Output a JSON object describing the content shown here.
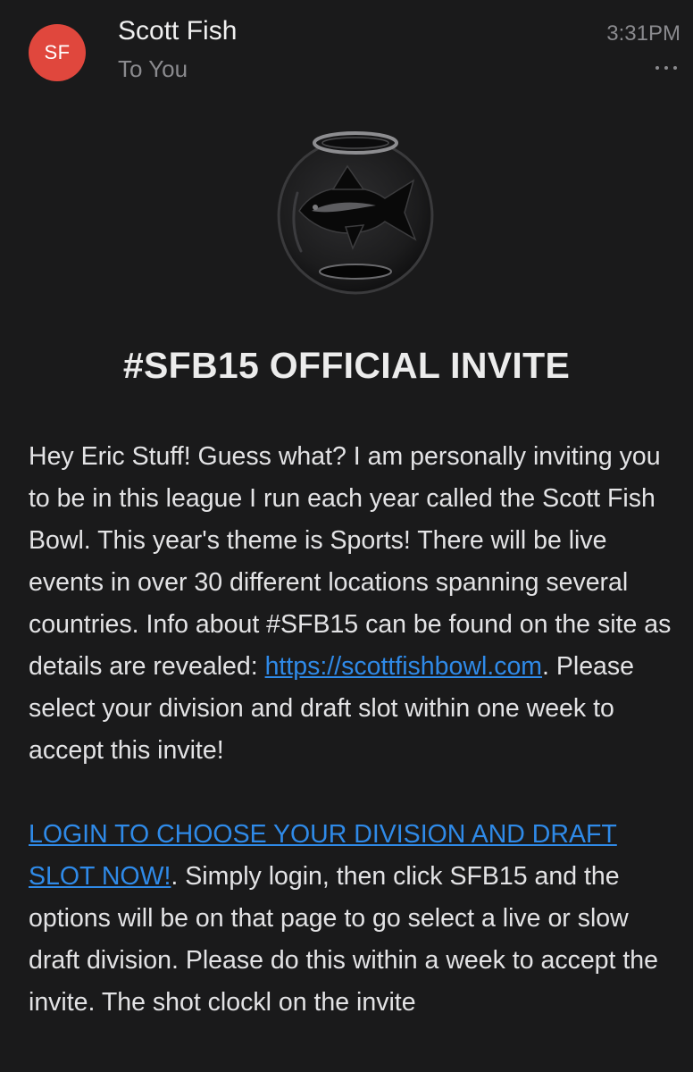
{
  "header": {
    "avatar_initials": "SF",
    "avatar_color": "#e0473d",
    "sender_name": "Scott Fish",
    "recipient": "To You",
    "time": "3:31PM"
  },
  "email": {
    "title": "#SFB15 OFFICIAL INVITE",
    "para1_before_link": "Hey Eric Stuff! Guess what? I am personally inviting you to be in this league I run each year called the Scott Fish Bowl. This year's theme is Sports! There will be live events in over 30 different locations spanning several countries. Info about #SFB15 can be found on the site as details are revealed: ",
    "site_link": "https://scottfishbowl.com",
    "para1_after_link": ". Please select your division and draft slot within one week to accept this invite!",
    "login_link": "LOGIN TO CHOOSE YOUR DIVISION AND DRAFT SLOT NOW!",
    "para2_after_link": ". Simply login, then click SFB15 and the options will be on that page to go select a live or slow draft division. Please do this within a week to accept the invite. The shot clockl on the invite"
  },
  "colors": {
    "background": "#1a1a1b",
    "link": "#2f8ae8",
    "text": "#e3e3e5",
    "muted": "#8a8a8e"
  },
  "icons": {
    "logo": "fishbowl-logo-icon",
    "more": "more-options-icon"
  }
}
